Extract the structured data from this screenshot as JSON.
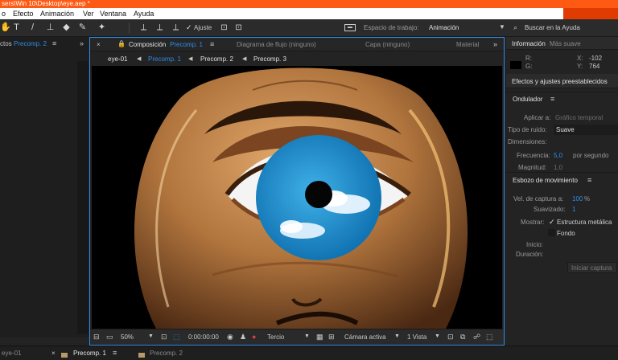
{
  "titlebar": {
    "text": "sers\\Win 10\\Desktop\\eye.aep *"
  },
  "menu": [
    "Archivo",
    "Efecto",
    "Animación",
    "Ver",
    "Ventana",
    "Ayuda"
  ],
  "menu_first_visible": "o",
  "toolbar": {
    "ajuste_label": "Ajuste",
    "workspace_label": "Espacio de trabajo:",
    "workspace_value": "Animación",
    "search_label": "Buscar en la Ayuda"
  },
  "left_panel": {
    "tab_prefix": "ctos",
    "tab_active": "Precomp. 2"
  },
  "comp_panel": {
    "tabs": [
      {
        "label": "Composición",
        "name": "Precomp. 1",
        "active": true
      },
      {
        "label": "Diagrama de flujo (ninguno)",
        "active": false
      },
      {
        "label": "Capa (ninguno)",
        "active": false
      },
      {
        "label": "Material",
        "active": false
      }
    ],
    "breadcrumbs": [
      "eye-01",
      "Precomp. 1",
      "Precomp. 2",
      "Precomp. 3"
    ],
    "bottom": {
      "zoom": "50%",
      "timecode": "0:00:00:00",
      "resolution": "Tercio",
      "camera": "Cámara activa",
      "views": "1 Vista"
    }
  },
  "right_panel": {
    "tabs": [
      "Información",
      "Más suave"
    ],
    "info": {
      "r_label": "R:",
      "g_label": "G:",
      "x_label": "X:",
      "x_value": "-102",
      "y_label": "Y:",
      "y_value": "764"
    },
    "effects_title": "Efectos y ajustes preestablecidos",
    "ondulador": {
      "title": "Ondulador",
      "apply_label": "Aplicar a:",
      "apply_value": "Gráfico temporal",
      "noise_label": "Tipo de ruido:",
      "noise_value": "Suave",
      "dims_label": "Dimensiones:",
      "freq_label": "Frecuencia:",
      "freq_value": "5,0",
      "freq_unit": "por segundo",
      "mag_label": "Magnitud:",
      "mag_value": "1,0"
    },
    "esbozo": {
      "title": "Esbozo de movimiento",
      "capture_label": "Vel. de captura a:",
      "capture_value": "100",
      "capture_unit": "%",
      "smooth_label": "Suavizado:",
      "smooth_value": "1",
      "show_label": "Mostrar:",
      "wire_label": "Estructura metálica",
      "wire_checked": true,
      "bg_label": "Fondo",
      "bg_checked": false,
      "start_label": "Inicio:",
      "duration_label": "Duración:",
      "start_button": "Iniciar captura"
    }
  },
  "timeline_tabs": [
    "eye-01",
    "Precomp. 1",
    "Precomp. 2"
  ],
  "colors": {
    "accent": "#2d8ceb",
    "title_bar": "#ff5a14",
    "sky": "#1a8fd1"
  }
}
